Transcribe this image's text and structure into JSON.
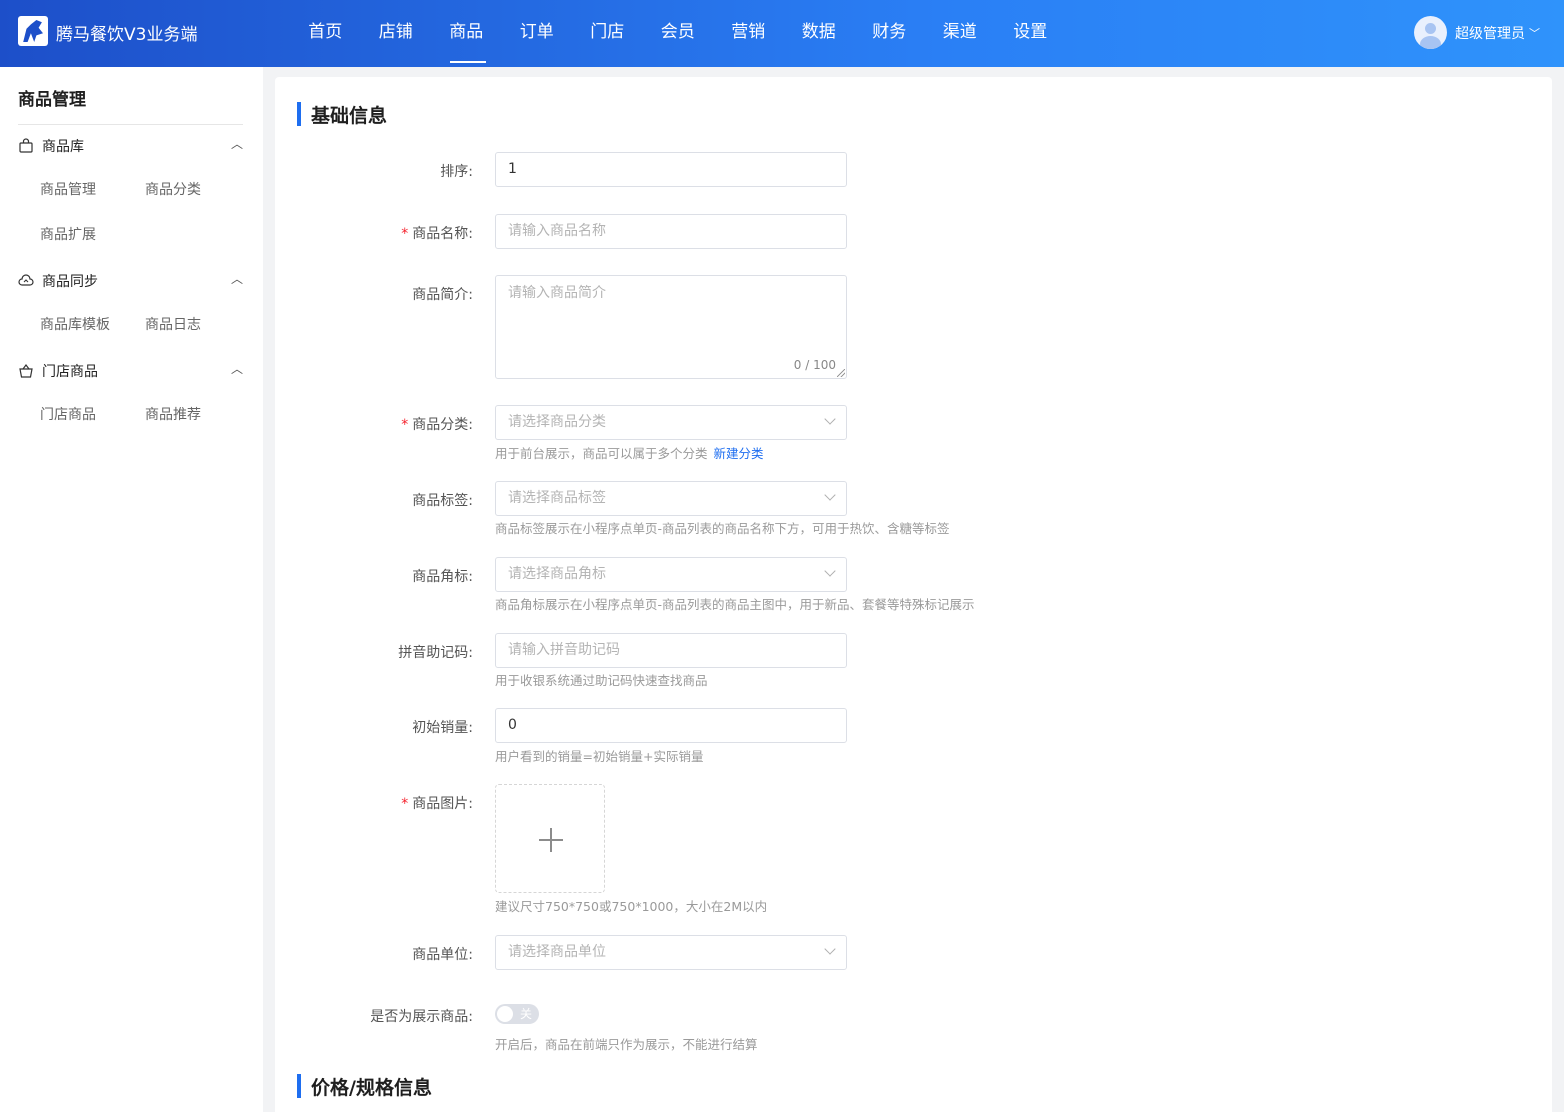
{
  "header": {
    "app_title": "腾马餐饮V3业务端",
    "nav": [
      "首页",
      "店铺",
      "商品",
      "订单",
      "门店",
      "会员",
      "营销",
      "数据",
      "财务",
      "渠道",
      "设置"
    ],
    "active_nav": "商品",
    "user_name": "超级管理员",
    "user_caret": "﹀"
  },
  "sidebar": {
    "title": "商品管理",
    "groups": [
      {
        "label": "商品库",
        "icon": "bag-icon",
        "caret": "︿",
        "items": [
          "商品管理",
          "商品分类",
          "商品扩展"
        ]
      },
      {
        "label": "商品同步",
        "icon": "cloud-sync-icon",
        "caret": "︿",
        "items": [
          "商品库模板",
          "商品日志"
        ]
      },
      {
        "label": "门店商品",
        "icon": "basket-icon",
        "caret": "︿",
        "items": [
          "门店商品",
          "商品推荐"
        ]
      }
    ]
  },
  "form": {
    "section_basic": "基础信息",
    "section_price": "价格/规格信息",
    "sort": {
      "label": "排序:",
      "value": "1"
    },
    "name": {
      "label": "商品名称:",
      "placeholder": "请输入商品名称"
    },
    "intro": {
      "label": "商品简介:",
      "placeholder": "请输入商品简介",
      "count": "0 / 100"
    },
    "category": {
      "label": "商品分类:",
      "placeholder": "请选择商品分类",
      "hint": "用于前台展示，商品可以属于多个分类",
      "link": "新建分类"
    },
    "tag": {
      "label": "商品标签:",
      "placeholder": "请选择商品标签",
      "hint": "商品标签展示在小程序点单页-商品列表的商品名称下方，可用于热饮、含糖等标签"
    },
    "corner": {
      "label": "商品角标:",
      "placeholder": "请选择商品角标",
      "hint": "商品角标展示在小程序点单页-商品列表的商品主图中，用于新品、套餐等特殊标记展示"
    },
    "pinyin": {
      "label": "拼音助记码:",
      "placeholder": "请输入拼音助记码",
      "hint": "用于收银系统通过助记码快速查找商品"
    },
    "sales": {
      "label": "初始销量:",
      "value": "0",
      "hint": "用户看到的销量=初始销量+实际销量"
    },
    "image": {
      "label": "商品图片:",
      "hint": "建议尺寸750*750或750*1000，大小在2M以内"
    },
    "unit": {
      "label": "商品单位:",
      "placeholder": "请选择商品单位"
    },
    "display": {
      "label": "是否为展示商品:",
      "switch_text": "关",
      "hint": "开启后，商品在前端只作为展示，不能进行结算"
    }
  },
  "colors": {
    "accent": "#1e6ef0",
    "required": "#f5222d",
    "header_start": "#1d4fc9",
    "header_end": "#2f93fb"
  }
}
